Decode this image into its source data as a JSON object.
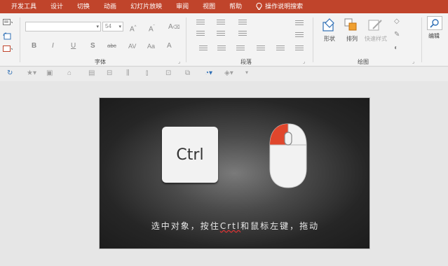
{
  "menubar": {
    "tabs": [
      "开发工具",
      "设计",
      "切换",
      "动画",
      "幻灯片放映",
      "审阅",
      "视图",
      "帮助"
    ],
    "tell_me": "操作说明搜索"
  },
  "ribbon": {
    "font_size_value": "54",
    "groups": {
      "font": "字体",
      "paragraph": "段落",
      "drawing": "绘图"
    },
    "drawing": {
      "shapes": "形状",
      "arrange": "排列",
      "quick_styles": "快速样式"
    },
    "editing": {
      "label": "编辑"
    },
    "font_buttons": [
      "B",
      "I",
      "U",
      "S",
      "abc",
      "AV",
      "Aa",
      "A"
    ]
  },
  "slide": {
    "key_label": "Ctrl",
    "caption_before": "选中对象，按住",
    "caption_underlined": "Crtl",
    "caption_after": "和鼠标左键，拖动",
    "colors": {
      "mouse_left_button": "#e0462c",
      "mouse_body": "#f2f2f2"
    }
  }
}
